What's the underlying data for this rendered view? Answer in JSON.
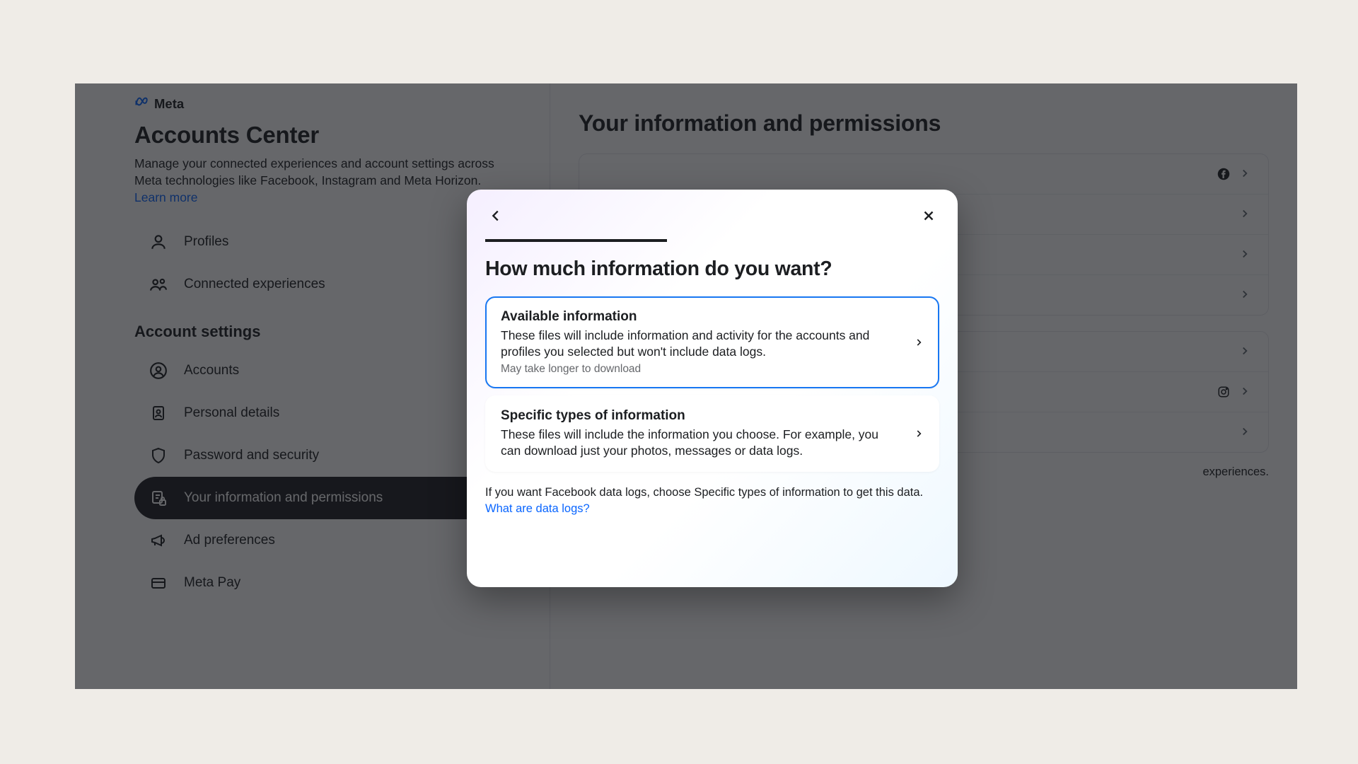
{
  "brand": {
    "name": "Meta"
  },
  "sidebar": {
    "title": "Accounts Center",
    "description": "Manage your connected experiences and account settings across Meta technologies like Facebook, Instagram and Meta Horizon.",
    "learn_more": "Learn more",
    "nav_top": [
      {
        "label": "Profiles"
      },
      {
        "label": "Connected experiences"
      }
    ],
    "section_title": "Account settings",
    "nav_settings": [
      {
        "label": "Accounts"
      },
      {
        "label": "Personal details"
      },
      {
        "label": "Password and security"
      },
      {
        "label": "Your information and permissions"
      },
      {
        "label": "Ad preferences"
      },
      {
        "label": "Meta Pay"
      }
    ]
  },
  "main": {
    "title": "Your information and permissions",
    "footer_fragment": " experiences."
  },
  "modal": {
    "title": "How much information do you want?",
    "progress_percent": 40,
    "options": [
      {
        "title": "Available information",
        "desc": "These files will include information and activity for the accounts and profiles you selected but won't include data logs.",
        "note": "May take longer to download"
      },
      {
        "title": "Specific types of information",
        "desc": "These files will include the information you choose. For example, you can download just your photos, messages or data logs."
      }
    ],
    "footer_text": "If you want Facebook data logs, choose Specific types of information to get this data. ",
    "footer_link": "What are data logs?"
  }
}
